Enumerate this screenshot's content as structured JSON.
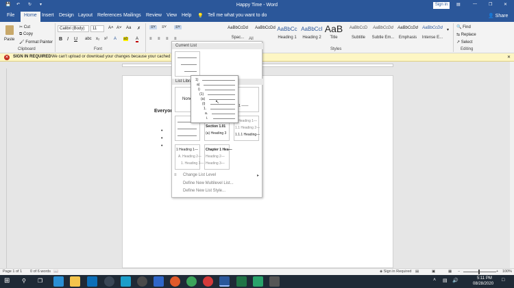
{
  "app": {
    "title": "Happy Time - Word"
  },
  "titlebar": {
    "signin": "Sign in"
  },
  "menu": {
    "tabs": [
      "File",
      "Home",
      "Insert",
      "Design",
      "Layout",
      "References",
      "Mailings",
      "Review",
      "View",
      "Help"
    ],
    "tell_me": "Tell me what you want to do",
    "share": "Share"
  },
  "ribbon": {
    "clipboard": {
      "paste": "Paste",
      "cut": "Cut",
      "copy": "Copy",
      "format_painter": "Format Painter",
      "label": "Clipboard"
    },
    "font": {
      "name": "Calibri (Body)",
      "size": "11",
      "label": "Font"
    },
    "styles": {
      "items": [
        {
          "preview": "AaBbCcDd",
          "name": "Spac..."
        },
        {
          "preview": "AaBbCc",
          "name": "Heading 1"
        },
        {
          "preview": "AaBbCcI",
          "name": "Heading 2"
        },
        {
          "preview": "AaB",
          "name": "Title"
        },
        {
          "preview": "AaBbCcD",
          "name": "Subtitle"
        },
        {
          "preview": "AaBbCcDd",
          "name": "Subtle Em..."
        },
        {
          "preview": "AaBbCcDd",
          "name": "Emphasis"
        },
        {
          "preview": "AaBbCcDd",
          "name": "Intense E..."
        }
      ],
      "label": "Styles"
    },
    "editing": {
      "find": "Find",
      "replace": "Replace",
      "select": "Select",
      "label": "Editing"
    }
  },
  "message_bar": {
    "title": "SIGN IN REQUIRED",
    "text": "We can't upload or download your changes because your cached cre"
  },
  "document": {
    "heading_fragment": "Everyon",
    "bullets": [
      "",
      "",
      ""
    ]
  },
  "dropdown": {
    "filter": "All",
    "current_list": "Current List",
    "list_library": "List Library",
    "none_label": "None",
    "tiles": [
      {
        "lines": [
          "1.1 ——"
        ]
      },
      {
        "lines": [
          "Article I. Headi—",
          "Section 1.01 Hea—",
          "(a) Heading 3—"
        ]
      },
      {
        "lines": [
          "1 Heading 1—",
          "1.1 Heading 2—",
          "1.1.1 Heading—"
        ]
      },
      {
        "lines": [
          "1 Heading 1—",
          "A. Heading 2—",
          "1. Heading 3—"
        ]
      },
      {
        "lines": [
          "Chapter 1 Hea—",
          "Heading 2—",
          "Heading 3—"
        ]
      }
    ],
    "tile_section_text": "Section 1.01",
    "tile_a_text": "(a) Heading 3",
    "menu_items": [
      "Change List Level",
      "Define New Multilevel List...",
      "Define New List Style..."
    ]
  },
  "popup": {
    "levels": [
      "1)",
      "a)",
      "i)",
      "(1)",
      "(a)",
      "(i)",
      "1.",
      "a.",
      "i."
    ]
  },
  "status": {
    "page": "Page 1 of 1",
    "words": "0 of 6 words",
    "accessibility": "Sign in Required",
    "zoom": "100%"
  },
  "taskbar": {
    "time": "5:11 PM",
    "date": "08/28/2020"
  }
}
